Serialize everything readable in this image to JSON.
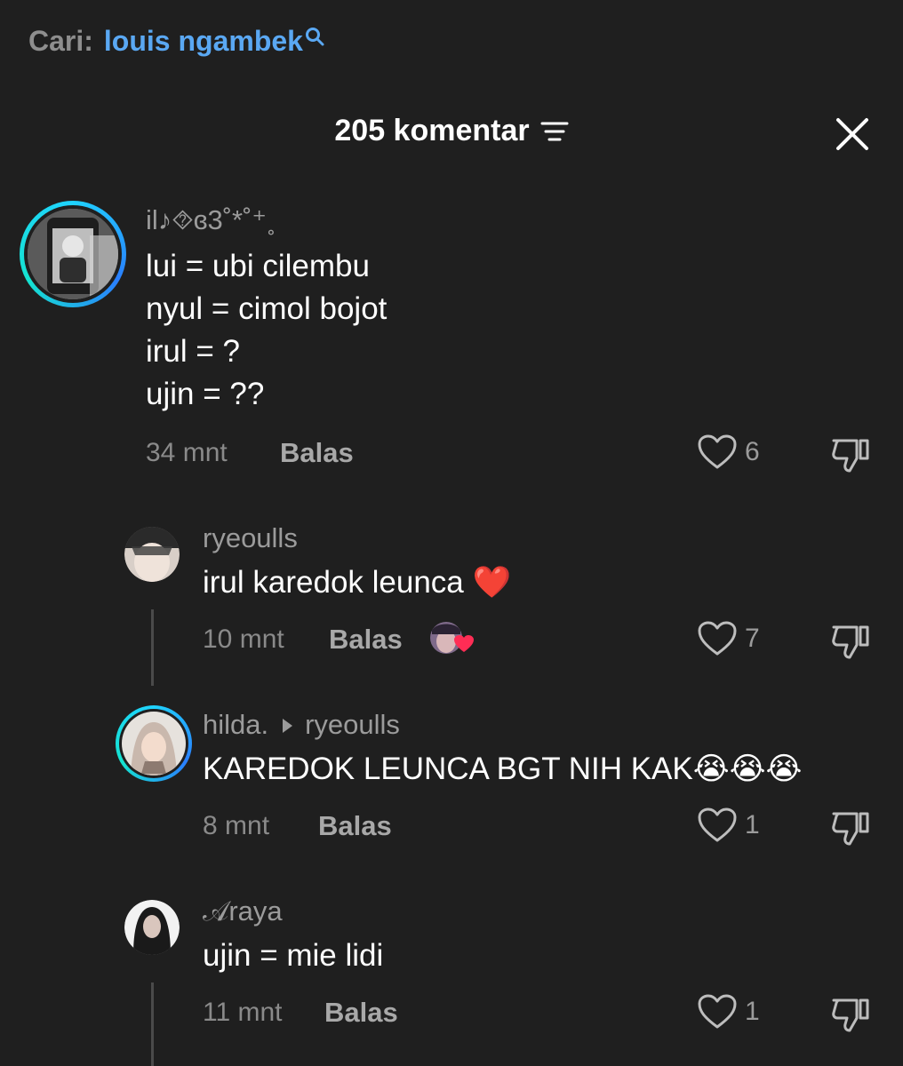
{
  "search": {
    "label": "Cari:",
    "query": "louis ngambek"
  },
  "header": {
    "count_text": "205 komentar"
  },
  "comments": [
    {
      "username": "il♪⯑ɞ3˚*˚⁺˳",
      "lines": [
        "lui = ubi cilembu",
        "nyul = cimol bojot",
        "irul = ?",
        "ujin = ??"
      ],
      "time": "34 mnt",
      "reply": "Balas",
      "likes": "6"
    },
    {
      "username": "ryeoulls",
      "text": "irul karedok leunca ❤️",
      "time": "10 mnt",
      "reply": "Balas",
      "likes": "7"
    },
    {
      "username": "hilda.",
      "reply_to": "ryeoulls",
      "text": "KAREDOK LEUNCA BGT NIH KAK😭😭😭",
      "time": "8 mnt",
      "reply": "Balas",
      "likes": "1"
    },
    {
      "username": "𝒜raya",
      "text": "ujin = mie lidi",
      "time": "11 mnt",
      "reply": "Balas",
      "likes": "1"
    }
  ],
  "colors": {
    "background": "#1f1f1f",
    "link": "#5aa8f3",
    "ring": "#1fd3ff"
  }
}
